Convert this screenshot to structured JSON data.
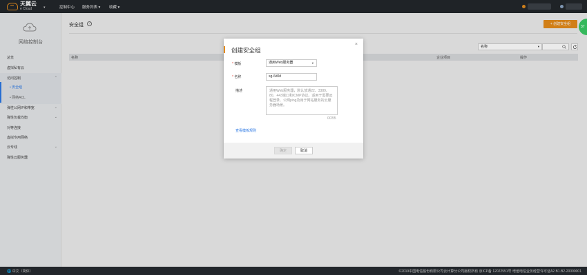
{
  "topbar": {
    "logo_cn": "天翼云",
    "logo_en": "e Cloud",
    "nav": [
      "控制中心",
      "服务列表 ▾",
      "收藏 ▾"
    ],
    "colors": {
      "bg": "#22262b",
      "accent": "#e08a1e"
    }
  },
  "sidebar": {
    "title": "网络控制台",
    "items": [
      {
        "label": "总览"
      },
      {
        "label": "虚拟私有云"
      },
      {
        "label": "访问控制"
      },
      {
        "label": "弹性公网IP和带宽"
      },
      {
        "label": "弹性负载均衡"
      },
      {
        "label": "对等连接"
      },
      {
        "label": "虚拟专用网络"
      },
      {
        "label": "云专线"
      },
      {
        "label": "弹性云服务器"
      }
    ],
    "sub_items": [
      {
        "label": "安全组"
      },
      {
        "label": "网络ACL"
      }
    ]
  },
  "main": {
    "page_title": "安全组",
    "help": "?",
    "create_button": "+ 创建安全组",
    "filter_select": "名称",
    "table_headers": [
      "名称",
      "企业项目",
      "操作"
    ]
  },
  "dialog": {
    "title": "创建安全组",
    "close": "×",
    "template_label": "模板",
    "template_value": "通用Web服务器",
    "name_label": "名称",
    "name_value": "sg-6d0d",
    "desc_label": "描述",
    "desc_value": "通用Web服务器，默认放通22、3389、80、443端口和ICMP协议。适用于需要远程登录、公网ping及用于网站服务的云服务器场景。",
    "char_count": "0/255",
    "rule_link": "查看模板规则",
    "ok_button": "确定",
    "cancel_button": "取消"
  },
  "footer": {
    "left": "🌐 中文（简体）",
    "right": "©2019中国电信股份有限公司云计算分公司版权所有  京ICP备 12022551号  增值电信业务经营许可证A2.B1.B2-20090001"
  },
  "badge": {
    "label": "37"
  }
}
